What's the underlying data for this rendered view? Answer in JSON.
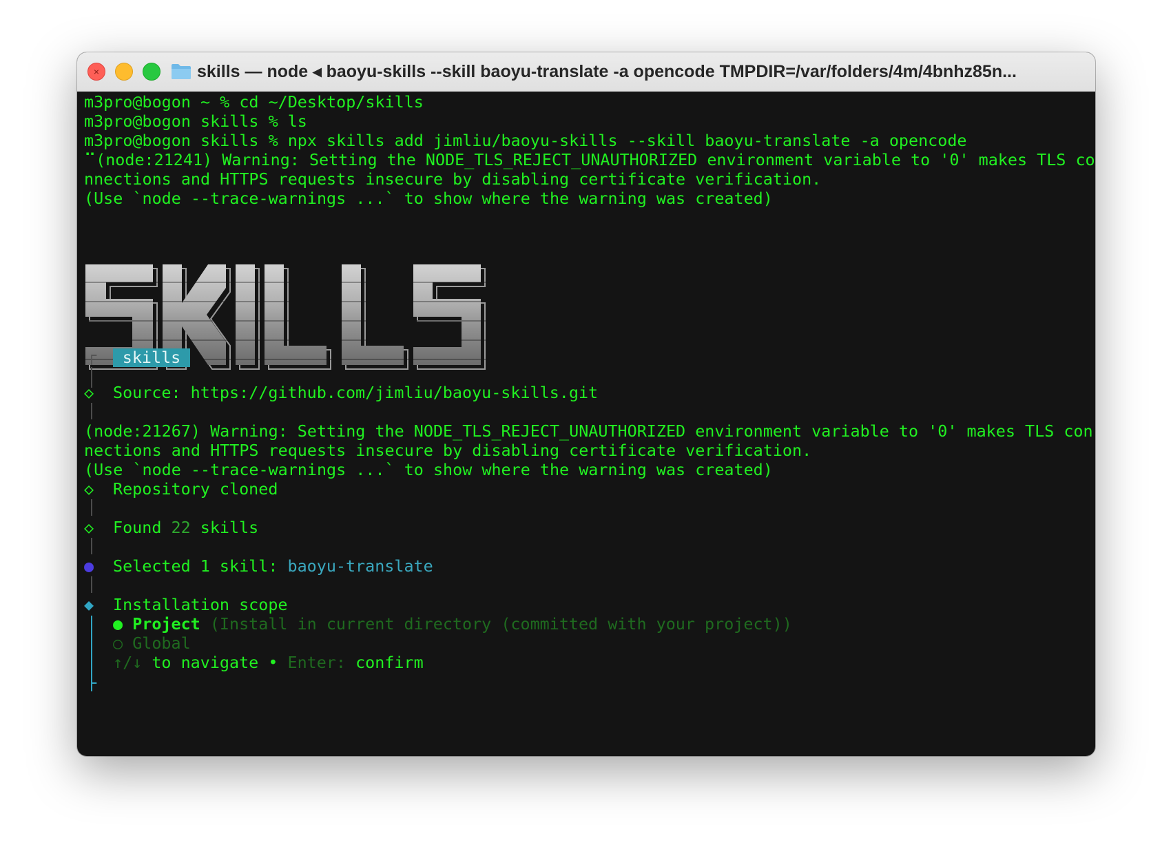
{
  "window": {
    "title": "skills — node ◂ baoyu-skills --skill baoyu-translate -a opencode TMPDIR=/var/folders/4m/4bnhz85n..."
  },
  "terminal": {
    "lines": {
      "cmd_cd": "m3pro@bogon ~ % cd ~/Desktop/skills",
      "cmd_ls": "m3pro@bogon skills % ls",
      "cmd_npx": "m3pro@bogon skills % npx skills add jimliu/baoyu-skills --skill baoyu-translate -a opencode",
      "warn1_a": "⠉(node:21241) Warning: Setting the NODE_TLS_REJECT_UNAUTHORIZED environment variable to '0' makes TLS co",
      "warn1_b": "nnections and HTTPS requests insecure by disabling certificate verification.",
      "warn1_c": "(Use `node --trace-warnings ...` to show where the warning was created)",
      "warn2_a": "(node:21267) Warning: Setting the NODE_TLS_REJECT_UNAUTHORIZED environment variable to '0' makes TLS con",
      "warn2_b": "nections and HTTPS requests insecure by disabling certificate verification.",
      "warn2_c": "(Use `node --trace-warnings ...` to show where the warning was created)"
    },
    "logo_text": "SKILLS",
    "badge": "skills",
    "steps": {
      "source": "Source: https://github.com/jimliu/baoyu-skills.git",
      "cloned": "Repository cloned",
      "found_prefix": "Found ",
      "found_count": "22",
      "found_suffix": " skills",
      "selected_prefix": "Selected 1 skill: ",
      "selected_skill": "baoyu-translate",
      "scope_title": "Installation scope"
    },
    "options": [
      {
        "marker": "●",
        "label": "Project",
        "hint": " (Install in current directory (committed with your project))",
        "selected": true
      },
      {
        "marker": "○",
        "label": "Global",
        "hint": "",
        "selected": false
      }
    ],
    "help": {
      "arrows": "↑/↓",
      "navigate": " to navigate",
      "sep": " • ",
      "enter": "Enter:",
      "confirm": " confirm"
    },
    "glyphs": {
      "corner_top": "┌",
      "corner_bottom": "└",
      "diamond_outline": "◇",
      "diamond_filled": "◆",
      "dot": "●"
    },
    "colors": {
      "text_green": "#21f021",
      "dim_green": "#1f6a1f",
      "accent_blue": "#3aa8bf",
      "dot_purple": "#4c3ce0",
      "background": "#141414"
    }
  }
}
